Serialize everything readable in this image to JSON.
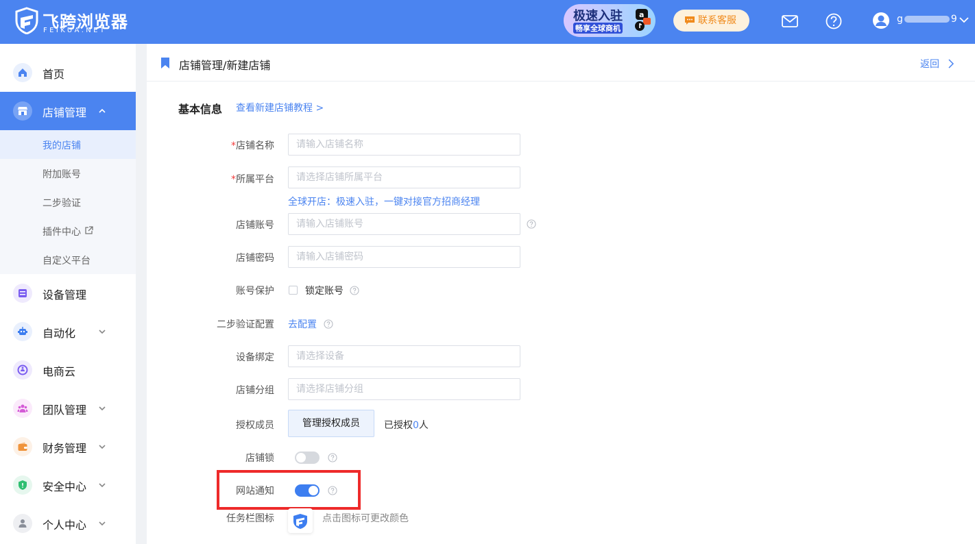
{
  "header": {
    "logo_name": "飞跨浏览器",
    "logo_sub": "FEIKUA.NET",
    "promo_line1": "极速入驻",
    "promo_line2": "畅享全球商机",
    "contact_label": "联系客服",
    "username_prefix": "g",
    "username_suffix": "9",
    "icons": [
      "mail-icon",
      "help-icon",
      "user-icon",
      "caret-down-icon"
    ]
  },
  "sidebar": {
    "items": [
      {
        "label": "首页",
        "icon": "home-icon",
        "color": "#4b84f0"
      },
      {
        "label": "店铺管理",
        "icon": "store-icon",
        "color": "#ffffff"
      },
      {
        "label": "设备管理",
        "icon": "device-icon",
        "color": "#7a5cf0"
      },
      {
        "label": "自动化",
        "icon": "robot-icon",
        "color": "#3d7ef0"
      },
      {
        "label": "电商云",
        "icon": "cloud-icon",
        "color": "#7a5cf0"
      },
      {
        "label": "团队管理",
        "icon": "team-icon",
        "color": "#d45ad6"
      },
      {
        "label": "财务管理",
        "icon": "wallet-icon",
        "color": "#f0943c"
      },
      {
        "label": "安全中心",
        "icon": "shield-icon",
        "color": "#2fbf71"
      },
      {
        "label": "个人中心",
        "icon": "person-icon",
        "color": "#8a8f99"
      }
    ],
    "submenu": [
      {
        "label": "我的店铺"
      },
      {
        "label": "附加账号"
      },
      {
        "label": "二步验证"
      },
      {
        "label": "插件中心"
      },
      {
        "label": "自定义平台"
      }
    ]
  },
  "page": {
    "breadcrumb": "店铺管理/新建店铺",
    "back_label": "返回",
    "section_title": "基本信息",
    "tutorial_link": "查看新建店铺教程 >"
  },
  "form": {
    "store_name": {
      "label": "店铺名称",
      "placeholder": "请输入店铺名称",
      "required_mark": "*"
    },
    "platform": {
      "label": "所属平台",
      "placeholder": "请选择店铺所属平台",
      "required_mark": "*",
      "hint": "全球开店：极速入驻，一键对接官方招商经理"
    },
    "account": {
      "label": "店铺账号",
      "placeholder": "请输入店铺账号"
    },
    "password": {
      "label": "店铺密码",
      "placeholder": "请输入店铺密码"
    },
    "protection": {
      "label": "账号保护",
      "checkbox_label": "锁定账号",
      "checked": false
    },
    "two_step": {
      "label": "二步验证配置",
      "link": "去配置"
    },
    "device": {
      "label": "设备绑定",
      "placeholder": "请选择设备"
    },
    "group": {
      "label": "店铺分组",
      "placeholder": "请选择店铺分组"
    },
    "members": {
      "label": "授权成员",
      "button": "管理授权成员",
      "authorized_prefix": "已授权",
      "authorized_count": "0",
      "authorized_suffix": "人"
    },
    "store_lock": {
      "label": "店铺锁",
      "enabled": false
    },
    "site_notice": {
      "label": "网站通知",
      "enabled": true
    },
    "taskbar_icon": {
      "label": "任务栏图标",
      "hint": "点击图标可更改颜色"
    }
  },
  "colors": {
    "brand": "#4b84f0",
    "highlight": "#ee2a2a",
    "required": "#f23c3c"
  }
}
